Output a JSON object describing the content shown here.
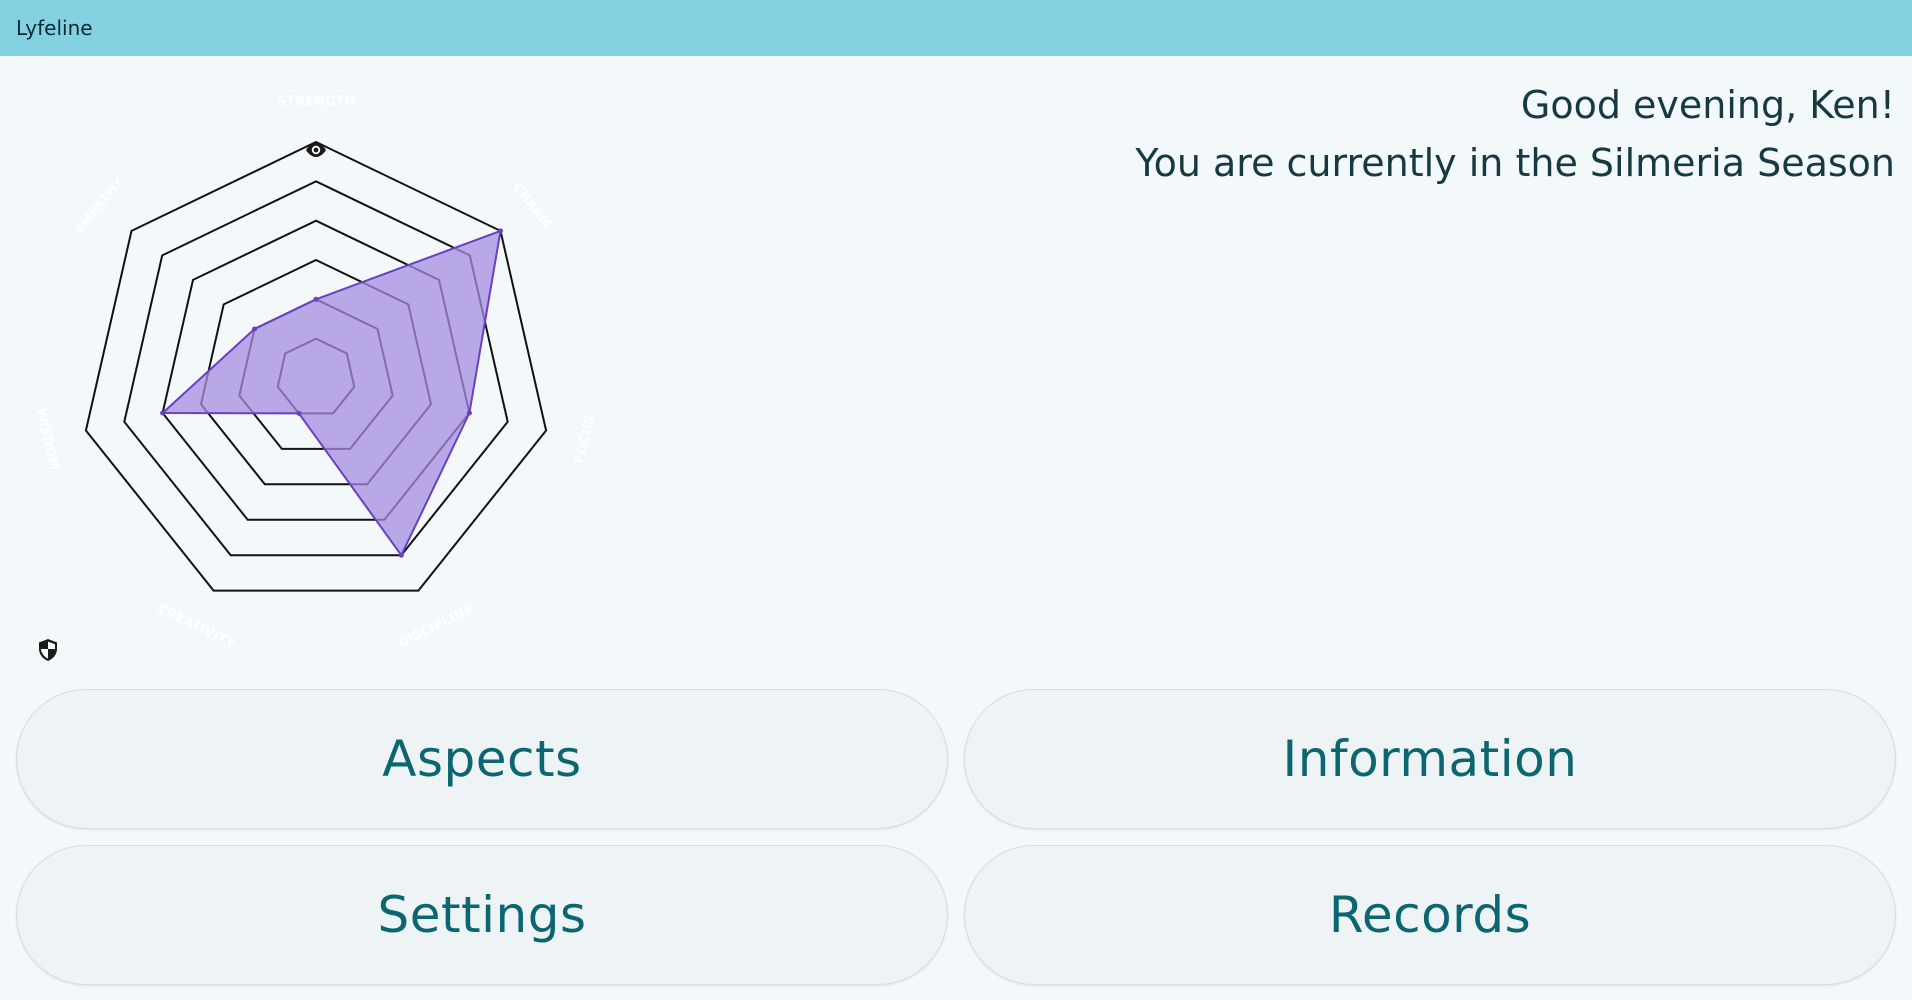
{
  "app": {
    "title": "Lyfeline"
  },
  "greeting": {
    "line1": "Good evening, Ken!",
    "line2": "You are currently in the Silmeria Season"
  },
  "chart_data": {
    "type": "radar",
    "axes": [
      "STRENGTH",
      "CHARM",
      "FOCUS",
      "DISCIPLINE",
      "CREATIVITY",
      "WISDOM",
      "EMPATHY"
    ],
    "rings": 6,
    "max": 6,
    "series": [
      {
        "values": [
          2,
          6,
          4,
          5,
          1,
          4,
          2
        ]
      }
    ],
    "colors": {
      "fill": "#a58ee0",
      "stroke": "#6a3fc2",
      "grid": "#111111",
      "axis_label": "#ffffff"
    }
  },
  "icons": {
    "eye": "eye-icon",
    "shield": "shield-icon"
  },
  "buttons": {
    "aspects": "Aspects",
    "information": "Information",
    "settings": "Settings",
    "records": "Records"
  }
}
